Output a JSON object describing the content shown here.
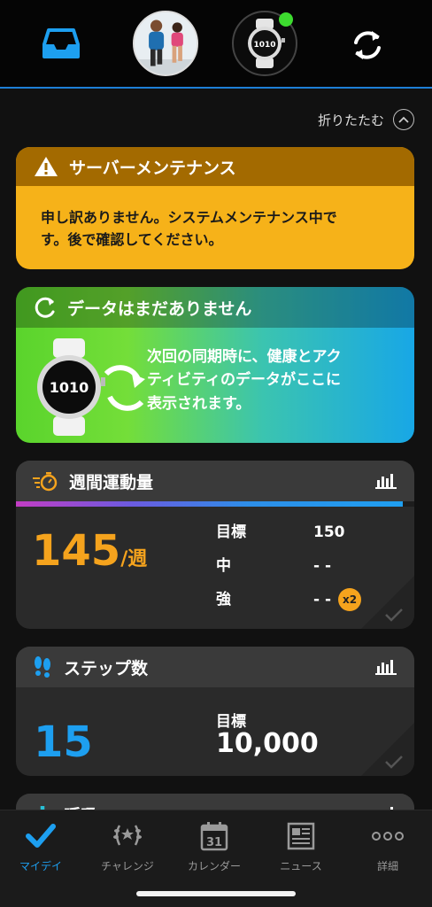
{
  "header": {
    "inbox_icon": "inbox-tray-icon",
    "avatar_icon": "profile-photo",
    "device_icon": "watch-device-icon",
    "sync_icon": "sync-icon",
    "colors": {
      "accent": "#1d7fd6",
      "connected": "#3ddc2f"
    }
  },
  "collapse": {
    "label": "折りたたむ",
    "icon": "chevron-up-icon"
  },
  "maintenance": {
    "title": "サーバーメンテナンス",
    "icon": "warning-icon",
    "message_line1": "申し訳ありません。システムメンテナンス中で",
    "message_line2": "す。後で確認してください。",
    "colors": {
      "header": "#a36a00",
      "body": "#f6b219"
    }
  },
  "no_data": {
    "title": "データはまだありません",
    "icon": "refresh-icon",
    "watch_time": "1010",
    "line1": "次回の同期時に、健康とアク",
    "line2": "ティビティのデータがここに",
    "line3": "表示されます。"
  },
  "intensity": {
    "title": "週間運動量",
    "icon": "stopwatch-icon",
    "value": "145",
    "unit": "/週",
    "progress": 0.97,
    "rows": [
      {
        "label": "目標",
        "value": "150"
      },
      {
        "label": "中",
        "value": "- -"
      },
      {
        "label": "強",
        "value": "- -",
        "badge": "x2"
      }
    ],
    "colors": {
      "value": "#f5a31d"
    }
  },
  "steps": {
    "title": "ステップ数",
    "icon": "footprints-icon",
    "value": "15",
    "goal_label": "目標",
    "goal_value": "10,000",
    "colors": {
      "value": "#1d9ff0"
    }
  },
  "respiration": {
    "title": "呼吸",
    "icon": "lungs-icon"
  },
  "nav": [
    {
      "label": "マイデイ",
      "icon": "checkmark-icon",
      "active": true
    },
    {
      "label": "チャレンジ",
      "icon": "laurel-icon",
      "active": false
    },
    {
      "label": "カレンダー",
      "icon": "calendar-icon",
      "day": "31",
      "active": false
    },
    {
      "label": "ニュース",
      "icon": "newspaper-icon",
      "active": false
    },
    {
      "label": "詳細",
      "icon": "more-dots-icon",
      "active": false
    }
  ]
}
